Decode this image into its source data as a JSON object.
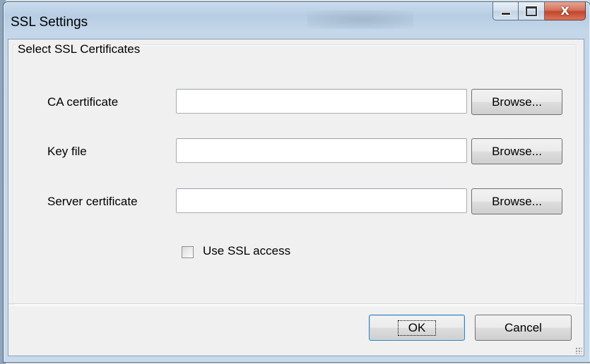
{
  "window": {
    "title": "SSL Settings"
  },
  "group": {
    "legend": "Select SSL Certificates"
  },
  "fields": [
    {
      "label": "CA certificate",
      "value": "",
      "browse_label": "Browse..."
    },
    {
      "label": "Key file",
      "value": "",
      "browse_label": "Browse..."
    },
    {
      "label": "Server certificate",
      "value": "",
      "browse_label": "Browse..."
    }
  ],
  "ssl_access": {
    "label": "Use SSL access",
    "checked": false
  },
  "footer": {
    "ok_label": "OK",
    "cancel_label": "Cancel"
  },
  "icons": {
    "minimize": "minimize-icon",
    "maximize": "maximize-icon",
    "close": "close-icon",
    "close_glyph": "X"
  },
  "colors": {
    "close_button": "#c2452b",
    "client_bg": "#f0f0f0",
    "default_button_border": "#3c7fb1"
  }
}
